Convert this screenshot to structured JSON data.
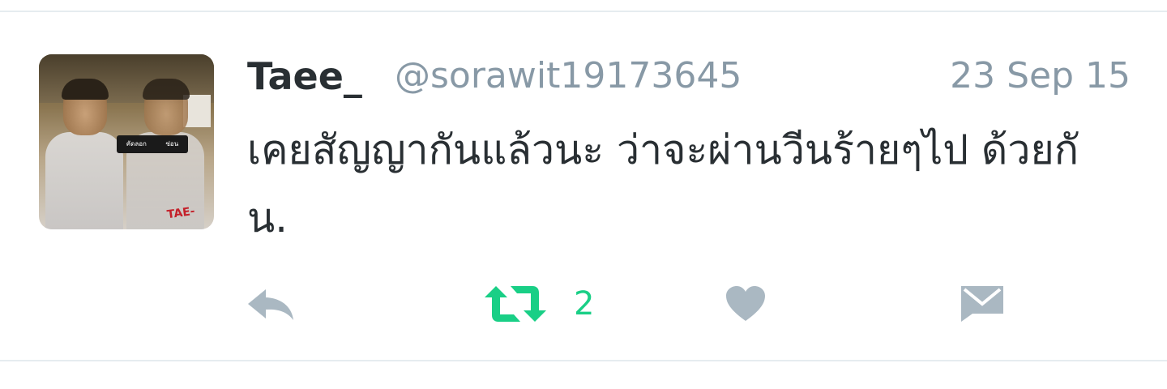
{
  "tweet": {
    "display_name": "Taee_",
    "handle": "@sorawit19173645",
    "timestamp": "23 Sep 15",
    "text": "เคยสัญญากันแล้วนะ ว่าจะผ่านวีนร้ายๆไป ด้วยกัน.",
    "avatar": {
      "overlay_menu_items": [
        "คัดลอก",
        "ซ่อน"
      ],
      "tag_text": "TAE-"
    }
  },
  "actions": {
    "reply": {
      "icon": "reply-icon"
    },
    "retweet": {
      "icon": "retweet-icon",
      "count": "2",
      "color": "#19cf86"
    },
    "like": {
      "icon": "heart-icon"
    },
    "direct_message": {
      "icon": "envelope-icon"
    }
  },
  "colors": {
    "text": "#292f33",
    "muted": "#8899a6",
    "icon_gray": "#aab8c2",
    "retweet_green": "#19cf86",
    "divider": "#e6ecf0"
  }
}
